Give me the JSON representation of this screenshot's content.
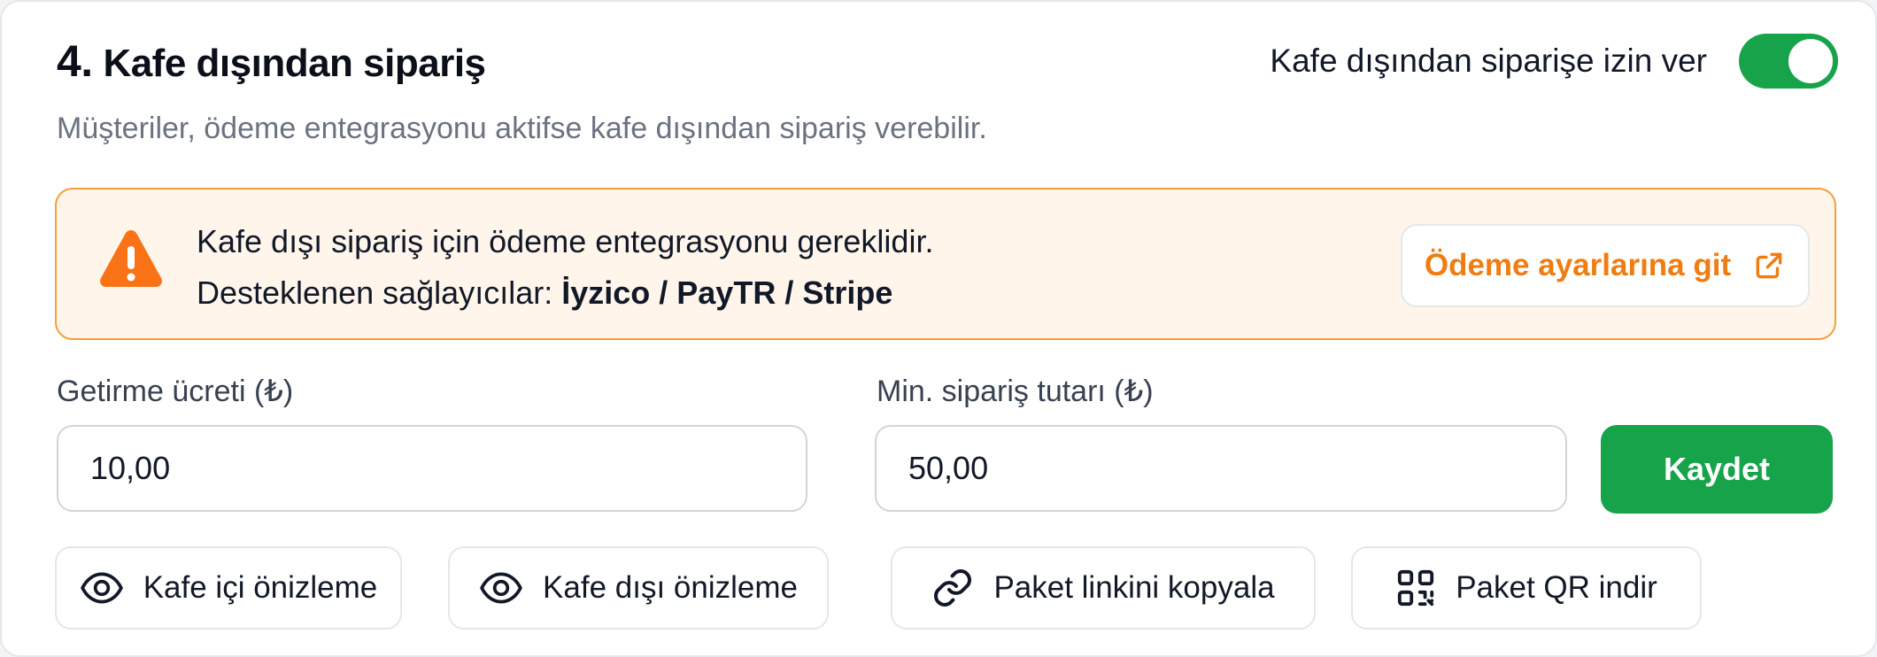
{
  "section": {
    "number": "4.",
    "title": "Kafe dışından sipariş",
    "subtitle": "Müşteriler, ödeme entegrasyonu aktifse kafe dışından sipariş verebilir."
  },
  "toggle": {
    "label": "Kafe dışından siparişe izin ver",
    "enabled": true,
    "on_color": "#16a34a"
  },
  "alert": {
    "icon": "warning-triangle-icon",
    "message": "Kafe dışı sipariş için ödeme entegrasyonu gereklidir.",
    "providers_label": "Desteklenen sağlayıcılar:",
    "providers": "İyzico / PayTR / Stripe",
    "button_label": "Ödeme ayarlarına git",
    "button_icon": "external-link-icon",
    "accent_color": "#f07d12"
  },
  "form": {
    "delivery_fee": {
      "label": "Getirme ücreti (₺)",
      "value": "10,00"
    },
    "min_order": {
      "label": "Min. sipariş tutarı (₺)",
      "value": "50,00"
    },
    "save_label": "Kaydet"
  },
  "actions": [
    {
      "label": "Kafe içi önizleme",
      "icon": "eye-icon"
    },
    {
      "label": "Kafe dışı önizleme",
      "icon": "eye-icon"
    },
    {
      "label": "Paket linkini kopyala",
      "icon": "link-icon"
    },
    {
      "label": "Paket QR indir",
      "icon": "qr-code-icon"
    }
  ]
}
